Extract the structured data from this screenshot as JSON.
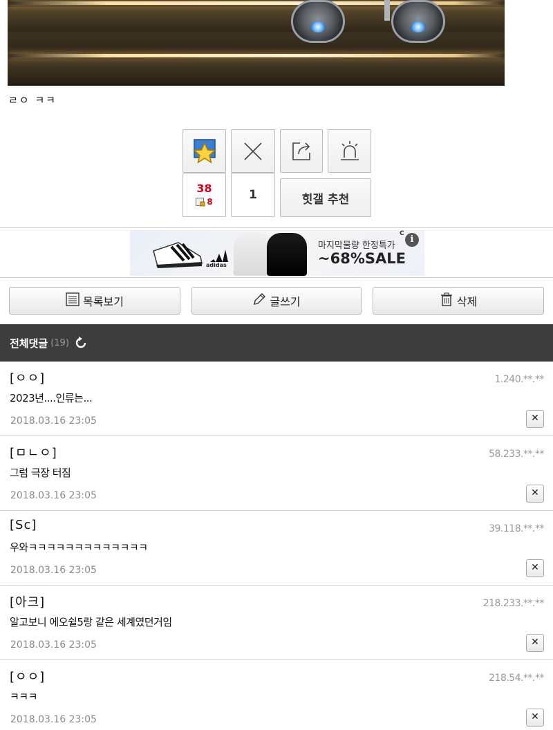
{
  "post": {
    "caption": "ㄹㅇ ㅋㅋ"
  },
  "actions": {
    "vote_count": "38",
    "vote_sub_count": "8",
    "cancel_count": "1",
    "recommend_label": "힛갤 추천"
  },
  "ad": {
    "line1": "마지막물량 한정특가",
    "line2": "~68%SALE",
    "brand": "adidas",
    "info_icon": "i",
    "corner": "C"
  },
  "nav": {
    "list_label": "목록보기",
    "write_label": "글쓰기",
    "delete_label": "삭제"
  },
  "comments_header": {
    "title": "전체댓글",
    "count": "(19)"
  },
  "comments": [
    {
      "nick": "[ㅇㅇ]",
      "ip": "1.240.**.**",
      "body": "2023년....인류는...",
      "date": "2018.03.16 23:05",
      "del": "✕"
    },
    {
      "nick": "[ㅁㄴㅇ]",
      "ip": "58.233.**.**",
      "body": "그럼 극장 터짐",
      "date": "2018.03.16 23:05",
      "del": "✕"
    },
    {
      "nick": "[Sc]",
      "ip": "39.118.**.**",
      "body": "우와ㅋㅋㅋㅋㅋㅋㅋㅋㅋㅋㅋㅋㅋ",
      "date": "2018.03.16 23:05",
      "del": "✕"
    },
    {
      "nick": "[아크]",
      "ip": "218.233.**.**",
      "body": "알고보니 에오쉴5랑 같은 세계였던거임",
      "date": "2018.03.16 23:05",
      "del": "✕"
    },
    {
      "nick": "[ㅇㅇ]",
      "ip": "218.54.**.**",
      "body": "ㅋㅋㅋ",
      "date": "2018.03.16 23:05",
      "del": "✕"
    }
  ],
  "colors": {
    "header_bg": "#3d3d3d",
    "count_red": "#d0021b"
  }
}
